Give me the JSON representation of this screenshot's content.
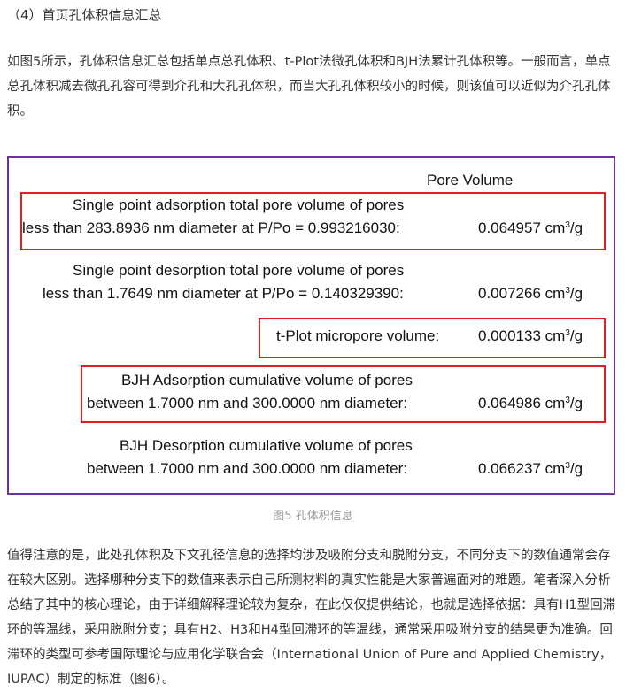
{
  "heading": "（4）首页孔体积信息汇总",
  "intro": "如图5所示，孔体积信息汇总包括单点总孔体积、t-Plot法微孔体积和BJH法累计孔体积等。一般而言，单点总孔体积减去微孔孔容可得到介孔和大孔孔体积，而当大孔孔体积较小的时候，则该值可以近似为介孔孔体积。",
  "figure": {
    "header": "Pore Volume",
    "unit_main": "cm",
    "unit_sup": "3",
    "unit_tail": "/g",
    "entries": [
      {
        "line1": "Single point adsorption total pore volume of pores",
        "line2": "less than 283.8936 nm diameter at P/Po = 0.993216030:",
        "value": "0.064957",
        "highlighted": true
      },
      {
        "line1": "Single point desorption total pore volume of pores",
        "line2": "less than 1.7649 nm diameter at P/Po = 0.140329390:",
        "value": "0.007266",
        "highlighted": false
      },
      {
        "line1": "t-Plot micropore volume:",
        "value": "0.000133",
        "highlighted": true
      },
      {
        "line1": "BJH Adsorption cumulative volume of pores",
        "line2": "between 1.7000 nm and 300.0000 nm diameter:",
        "value": "0.064986",
        "highlighted": true
      },
      {
        "line1": "BJH Desorption cumulative volume of pores",
        "line2": "between 1.7000 nm and 300.0000 nm diameter:",
        "value": "0.066237",
        "highlighted": false
      }
    ],
    "highlight_color": "#e02020",
    "frame_color": "#7030a0"
  },
  "caption": "图5 孔体积信息",
  "outro": "值得注意的是，此处孔体积及下文孔径信息的选择均涉及吸附分支和脱附分支，不同分支下的数值通常会存在较大区别。选择哪种分支下的数值来表示自己所测材料的真实性能是大家普遍面对的难题。笔者深入分析总结了其中的核心理论，由于详细解释理论较为复杂，在此仅仅提供结论，也就是选择依据：具有H1型回滞环的等温线，采用脱附分支；具有H2、H3和H4型回滞环的等温线，通常采用吸附分支的结果更为准确。回滞环的类型可参考国际理论与应用化学联合会（International Union of Pure and Applied Chemistry，IUPAC）制定的标准（图6）。"
}
